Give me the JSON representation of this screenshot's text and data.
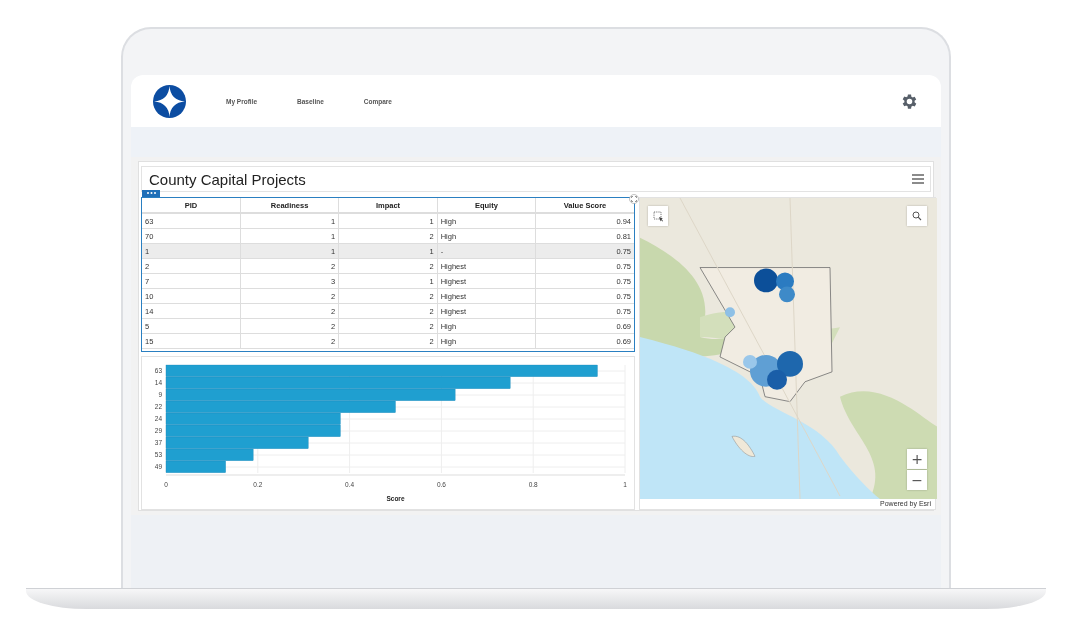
{
  "header": {
    "nav": [
      {
        "label": "My Profile"
      },
      {
        "label": "Baseline"
      },
      {
        "label": "Compare"
      }
    ]
  },
  "panel": {
    "title": "County Capital Projects"
  },
  "table": {
    "columns": [
      "PID",
      "Readiness",
      "Impact",
      "Equity",
      "Value Score"
    ],
    "rows": [
      {
        "cells": [
          "63",
          "1",
          "1",
          "High",
          "0.94"
        ],
        "selected": false
      },
      {
        "cells": [
          "70",
          "1",
          "2",
          "High",
          "0.81"
        ],
        "selected": false
      },
      {
        "cells": [
          "1",
          "1",
          "1",
          "-",
          "0.75"
        ],
        "selected": true
      },
      {
        "cells": [
          "2",
          "2",
          "2",
          "Highest",
          "0.75"
        ],
        "selected": false
      },
      {
        "cells": [
          "7",
          "3",
          "1",
          "Highest",
          "0.75"
        ],
        "selected": false
      },
      {
        "cells": [
          "10",
          "2",
          "2",
          "Highest",
          "0.75"
        ],
        "selected": false
      },
      {
        "cells": [
          "14",
          "2",
          "2",
          "Highest",
          "0.75"
        ],
        "selected": false
      },
      {
        "cells": [
          "5",
          "2",
          "2",
          "High",
          "0.69"
        ],
        "selected": false
      },
      {
        "cells": [
          "15",
          "2",
          "2",
          "High",
          "0.69"
        ],
        "selected": false
      }
    ]
  },
  "chart": {
    "chart_data": {
      "type": "bar",
      "orientation": "horizontal",
      "grid": true,
      "xlabel": "Score",
      "xlim": [
        0,
        1
      ],
      "xticks": [
        0,
        0.2,
        0.4,
        0.6,
        0.8,
        1
      ],
      "categories": [
        "63",
        "14",
        "9",
        "22",
        "24",
        "29",
        "37",
        "53",
        "49"
      ],
      "series": [
        {
          "color": "#1f9fd0",
          "values": [
            0.94,
            0.75,
            0.63,
            0.5,
            0.38,
            0.38,
            0.31,
            0.19,
            0.13
          ]
        }
      ]
    }
  },
  "map": {
    "kind": "picture",
    "zoom_in": "+",
    "zoom_out": "−",
    "attribution": "Powered by Esri"
  }
}
